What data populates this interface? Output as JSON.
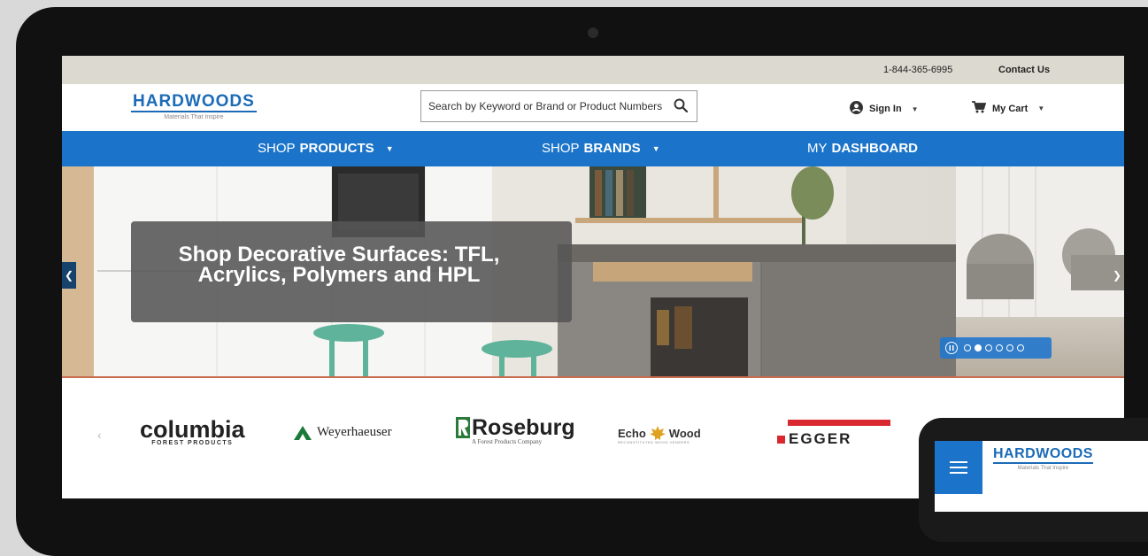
{
  "utility": {
    "phone": "1-844-365-6995",
    "contact": "Contact Us"
  },
  "header": {
    "logo_text": "HARDWOODS",
    "logo_tagline": "Materials That Inspire",
    "search_placeholder": "Search by Keyword or Brand or Product Numbers",
    "signin_label": "Sign In",
    "cart_label": "My Cart"
  },
  "nav": {
    "items": [
      {
        "prefix": "SHOP",
        "strong": "PRODUCTS"
      },
      {
        "prefix": "SHOP",
        "strong": "BRANDS"
      },
      {
        "prefix": "MY",
        "strong": "DASHBOARD"
      }
    ]
  },
  "hero": {
    "title_line1": "Shop Decorative Surfaces: TFL,",
    "title_line2": "Acrylics, Polymers and HPL",
    "slide_count": 6,
    "active_slide": 2
  },
  "brands": {
    "items": [
      {
        "name": "columbia",
        "sub": "FOREST PRODUCTS"
      },
      {
        "name": "Weyerhaeuser"
      },
      {
        "name": "Roseburg",
        "sub": "A Forest Products Company"
      },
      {
        "name": "Echo",
        "name2": "Wood",
        "sub": "RECONSTITUTED WOOD VENEERS"
      },
      {
        "name": "EGGER"
      }
    ]
  },
  "tablet": {
    "logo_text": "HARDWOODS",
    "logo_tagline": "Materials That Inspire"
  },
  "colors": {
    "nav_blue": "#1b74c9",
    "brand_blue": "#1b6bb8",
    "utility_bg": "#dcd9d0"
  }
}
